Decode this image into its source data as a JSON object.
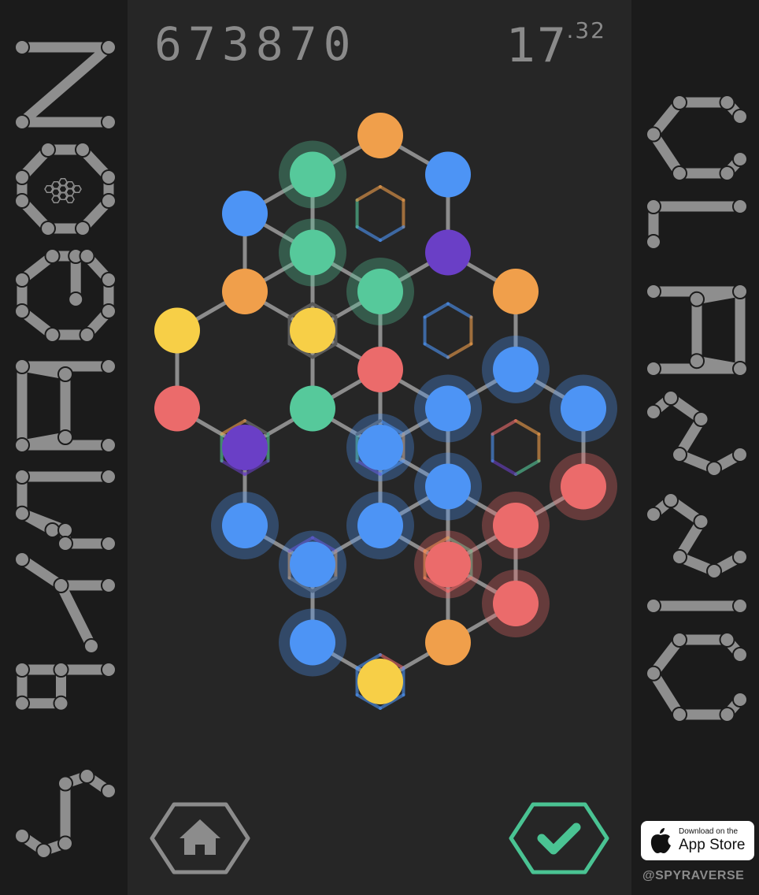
{
  "header": {
    "score": "673870",
    "timer_seconds": "17",
    "timer_fraction": ".32"
  },
  "title_left": "SPYRAGON",
  "title_right": "CLASSIC",
  "palette": {
    "orange": "#f09f4b",
    "blue": "#4d94f5",
    "green": "#56c99b",
    "purple": "#6a3fc6",
    "red": "#eb6b6b",
    "yellow": "#f7cf47",
    "edge": "#8c8c8c",
    "text": "#8a8a8a",
    "confirm": "#4ac393"
  },
  "buttons": {
    "home_icon": "home-icon",
    "confirm_icon": "checkmark-icon"
  },
  "app_store": {
    "line1": "Download on the",
    "line2": "App Store"
  },
  "handle": "@SPYRAVERSE",
  "board": {
    "nodes": [
      {
        "col": 0,
        "row": 5,
        "color": "yellow",
        "halo": false
      },
      {
        "col": 0,
        "row": 7,
        "color": "red",
        "halo": false
      },
      {
        "col": 1,
        "row": 4,
        "color": "orange",
        "halo": false
      },
      {
        "col": 1,
        "row": 8,
        "color": "purple",
        "halo": false
      },
      {
        "col": 1,
        "row": 2,
        "color": "blue",
        "halo": false
      },
      {
        "col": 1,
        "row": 10,
        "color": "blue",
        "halo": true
      },
      {
        "col": 2,
        "row": 1,
        "color": "green",
        "halo": true
      },
      {
        "col": 2,
        "row": 3,
        "color": "green",
        "halo": true
      },
      {
        "col": 2,
        "row": 5,
        "color": "yellow",
        "halo": false
      },
      {
        "col": 2,
        "row": 7,
        "color": "green",
        "halo": false
      },
      {
        "col": 2,
        "row": 11,
        "color": "blue",
        "halo": true
      },
      {
        "col": 2,
        "row": 13,
        "color": "blue",
        "halo": true
      },
      {
        "col": 3,
        "row": 0,
        "color": "orange",
        "halo": false
      },
      {
        "col": 3,
        "row": 4,
        "color": "green",
        "halo": true
      },
      {
        "col": 3,
        "row": 6,
        "color": "red",
        "halo": false
      },
      {
        "col": 3,
        "row": 8,
        "color": "blue",
        "halo": true
      },
      {
        "col": 3,
        "row": 10,
        "color": "blue",
        "halo": true
      },
      {
        "col": 3,
        "row": 14,
        "color": "yellow",
        "halo": false
      },
      {
        "col": 4,
        "row": 1,
        "color": "blue",
        "halo": false
      },
      {
        "col": 4,
        "row": 3,
        "color": "purple",
        "halo": false
      },
      {
        "col": 4,
        "row": 7,
        "color": "blue",
        "halo": true
      },
      {
        "col": 4,
        "row": 9,
        "color": "blue",
        "halo": true
      },
      {
        "col": 4,
        "row": 11,
        "color": "red",
        "halo": true
      },
      {
        "col": 4,
        "row": 13,
        "color": "orange",
        "halo": false
      },
      {
        "col": 5,
        "row": 4,
        "color": "orange",
        "halo": false
      },
      {
        "col": 5,
        "row": 6,
        "color": "blue",
        "halo": true
      },
      {
        "col": 5,
        "row": 10,
        "color": "red",
        "halo": true
      },
      {
        "col": 5,
        "row": 12,
        "color": "red",
        "halo": true
      },
      {
        "col": 6,
        "row": 7,
        "color": "blue",
        "halo": true
      },
      {
        "col": 6,
        "row": 9,
        "color": "red",
        "halo": true
      }
    ],
    "cells": [
      {
        "col": 3,
        "row": 2,
        "sides": [
          "orange",
          "orange",
          "blue",
          "blue",
          "green",
          "orange"
        ]
      },
      {
        "col": 2,
        "row": 5,
        "sides": [
          "gray",
          "gray",
          "gray",
          "gray",
          "gray",
          "gray"
        ]
      },
      {
        "col": 4,
        "row": 5,
        "sides": [
          "blue",
          "orange",
          "orange",
          "blue",
          "blue",
          "blue"
        ]
      },
      {
        "col": 1,
        "row": 8,
        "sides": [
          "gray",
          "green",
          "purple",
          "purple",
          "green",
          "orange"
        ]
      },
      {
        "col": 3,
        "row": 8,
        "sides": [
          "blue",
          "orange",
          "blue",
          "purple",
          "green",
          "gray"
        ]
      },
      {
        "col": 5,
        "row": 8,
        "sides": [
          "orange",
          "orange",
          "green",
          "purple",
          "blue",
          "red"
        ]
      },
      {
        "col": 2,
        "row": 11,
        "sides": [
          "purple",
          "orange",
          "gray",
          "gray",
          "orange",
          "purple"
        ]
      },
      {
        "col": 4,
        "row": 11,
        "sides": [
          "green",
          "green",
          "red",
          "red",
          "orange",
          "orange"
        ]
      },
      {
        "col": 3,
        "row": 14,
        "sides": [
          "red",
          "blue",
          "blue",
          "blue",
          "blue",
          "blue"
        ]
      }
    ]
  }
}
